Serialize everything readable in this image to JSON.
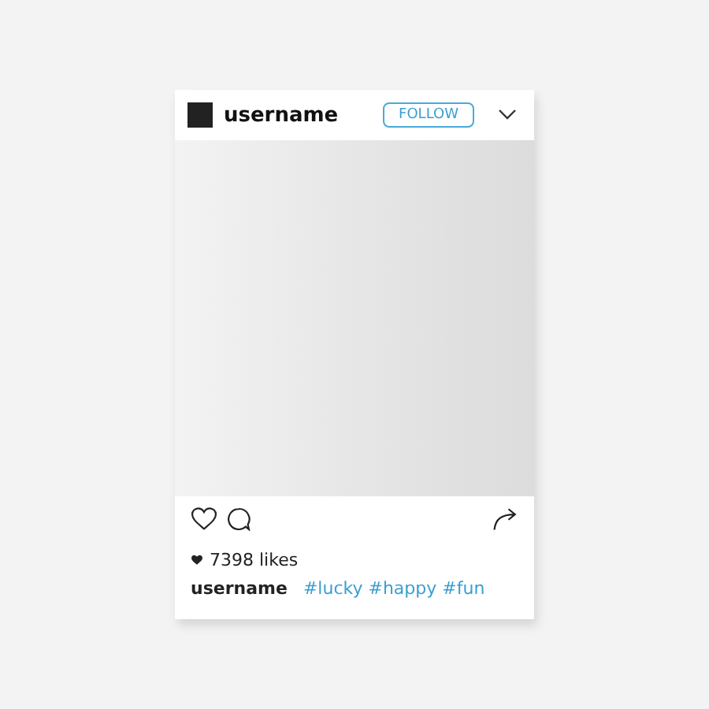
{
  "post": {
    "username": "username",
    "follow_button": "FOLLOW",
    "likes": "7398 likes",
    "caption": {
      "username": "username",
      "hashtags": "#lucky #happy #fun"
    }
  }
}
